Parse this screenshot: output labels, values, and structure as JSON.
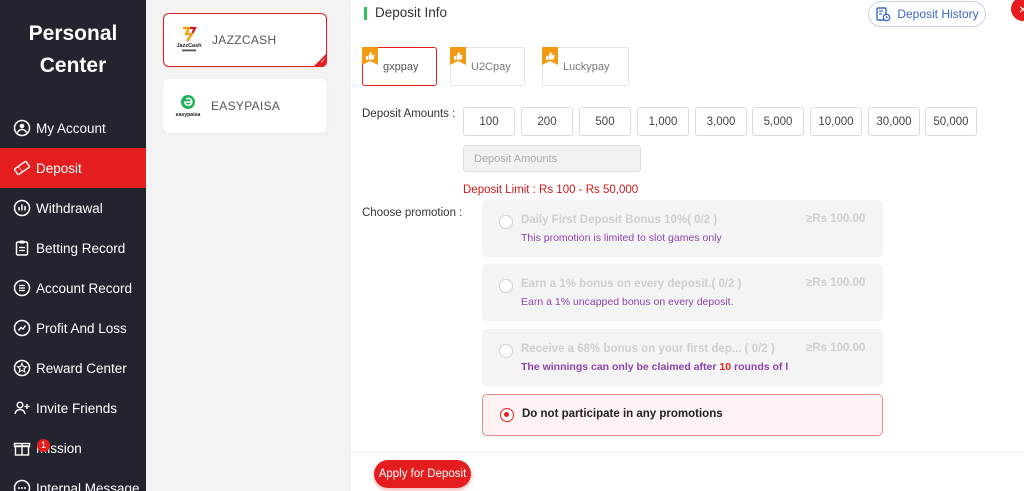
{
  "sidebar": {
    "title": "Personal Center",
    "items": [
      {
        "label": "My Account",
        "icon": "user-circle-icon"
      },
      {
        "label": "Deposit",
        "icon": "ticket-icon",
        "active": true
      },
      {
        "label": "Withdrawal",
        "icon": "bars-icon"
      },
      {
        "label": "Betting Record",
        "icon": "clipboard-icon"
      },
      {
        "label": "Account Record",
        "icon": "list-icon"
      },
      {
        "label": "Profit And Loss",
        "icon": "chart-icon"
      },
      {
        "label": "Reward Center",
        "icon": "star-circle-icon"
      },
      {
        "label": "Invite Friends",
        "icon": "invite-icon"
      },
      {
        "label": "Mission",
        "icon": "gift-icon",
        "badge": "1"
      },
      {
        "label": "Internal Message",
        "icon": "message-icon"
      }
    ]
  },
  "channels": [
    {
      "name": "JAZZCASH",
      "logo_text": "JazzCash",
      "selected": true
    },
    {
      "name": "EASYPAISA",
      "logo_text": "easypaisa",
      "selected": false
    }
  ],
  "main": {
    "section_title": "Deposit Info",
    "history_button": "Deposit History",
    "close": "×",
    "payment_options": [
      {
        "label": "gxppay",
        "selected": true
      },
      {
        "label": "U2Cpay",
        "selected": false
      },
      {
        "label": "Luckypay",
        "selected": false
      }
    ],
    "amount_label": "Deposit Amounts :",
    "amounts": [
      "100",
      "200",
      "500",
      "1,000",
      "3,000",
      "5,000",
      "10,000",
      "30,000",
      "50,000"
    ],
    "amount_placeholder": "Deposit Amounts",
    "limit_text": "Deposit Limit :  Rs  100  -  Rs  50,000",
    "promotion_label": "Choose promotion :",
    "promotions": [
      {
        "title": "Daily First Deposit Bonus 10%( 0/2 )",
        "min": "≥Rs   100.00",
        "desc": "This promotion is limited to slot games only"
      },
      {
        "title": "Earn a 1% bonus on every deposit.( 0/2 )",
        "min": "≥Rs   100.00",
        "desc": "Earn a 1% uncapped bonus on every deposit."
      },
      {
        "title": "Receive a 68% bonus on your first dep...  ( 0/2 )",
        "min": "≥Rs   100.00",
        "desc_pre": "The winnings can only be claimed after ",
        "desc_num": "10",
        "desc_post": " rounds of l"
      }
    ],
    "no_promotion": "Do not participate in any promotions",
    "submit": "Apply for Deposit"
  },
  "colors": {
    "accent": "#e41e1e",
    "sidebar_bg": "#22252e",
    "promo_desc": "#8e44ad",
    "section_bar": "#2cc35b"
  }
}
